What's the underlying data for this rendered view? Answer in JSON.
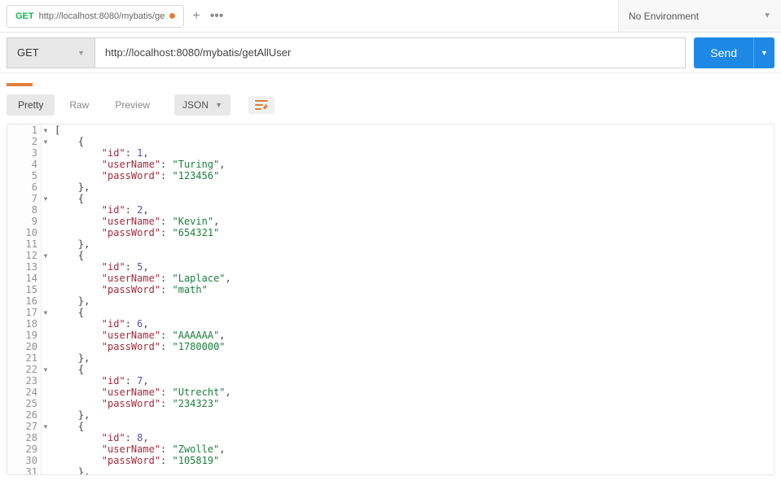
{
  "env": {
    "label": "No Environment"
  },
  "tab": {
    "method": "GET",
    "title": "http://localhost:8080/mybatis/ge",
    "modified": true
  },
  "request": {
    "method": "GET",
    "url": "http://localhost:8080/mybatis/getAllUser",
    "send": "Send"
  },
  "subtabs": {
    "pretty": "Pretty",
    "raw": "Raw",
    "preview": "Preview",
    "format": "JSON"
  },
  "body": {
    "users": [
      {
        "id": 1,
        "userName": "Turing",
        "passWord": "123456"
      },
      {
        "id": 2,
        "userName": "Kevin",
        "passWord": "654321"
      },
      {
        "id": 5,
        "userName": "Laplace",
        "passWord": "math"
      },
      {
        "id": 6,
        "userName": "AAAAAA",
        "passWord": "1780000"
      },
      {
        "id": 7,
        "userName": "Utrecht",
        "passWord": "234323"
      },
      {
        "id": 8,
        "userName": "Zwolle",
        "passWord": "105819"
      }
    ],
    "keys": {
      "id": "id",
      "userName": "userName",
      "passWord": "passWord"
    }
  }
}
